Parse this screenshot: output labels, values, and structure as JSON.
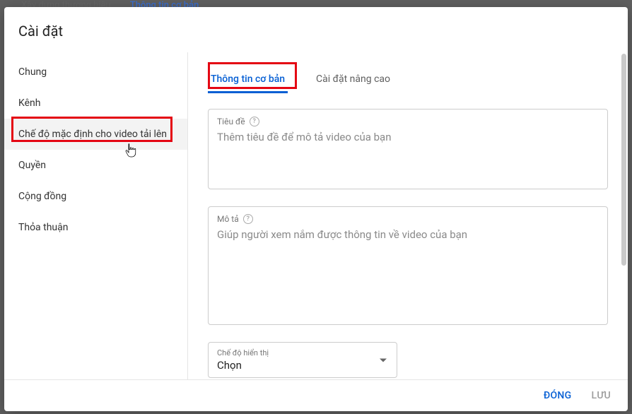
{
  "background": {
    "left_text": "Xây dựng thương hiệu",
    "right_text": "Thông tin cơ bản"
  },
  "dialog": {
    "title": "Cài đặt",
    "sidebar": {
      "items": [
        {
          "label": "Chung"
        },
        {
          "label": "Kênh"
        },
        {
          "label": "Chế độ mặc định cho video tải lên"
        },
        {
          "label": "Quyền"
        },
        {
          "label": "Cộng đồng"
        },
        {
          "label": "Thỏa thuận"
        }
      ],
      "selected_index": 2
    },
    "tabs": [
      {
        "label": "Thông tin cơ bản",
        "active": true
      },
      {
        "label": "Cài đặt nâng cao",
        "active": false
      }
    ],
    "fields": {
      "title": {
        "label": "Tiêu đề",
        "placeholder": "Thêm tiêu đề để mô tả video của bạn",
        "value": ""
      },
      "description": {
        "label": "Mô tả",
        "placeholder": "Giúp người xem nắm được thông tin về video của bạn",
        "value": ""
      },
      "visibility": {
        "label": "Chế độ hiển thị",
        "value": "Chọn"
      }
    },
    "footer": {
      "close": "ĐÓNG",
      "save": "LƯU"
    }
  },
  "highlight_color": "#e40613"
}
